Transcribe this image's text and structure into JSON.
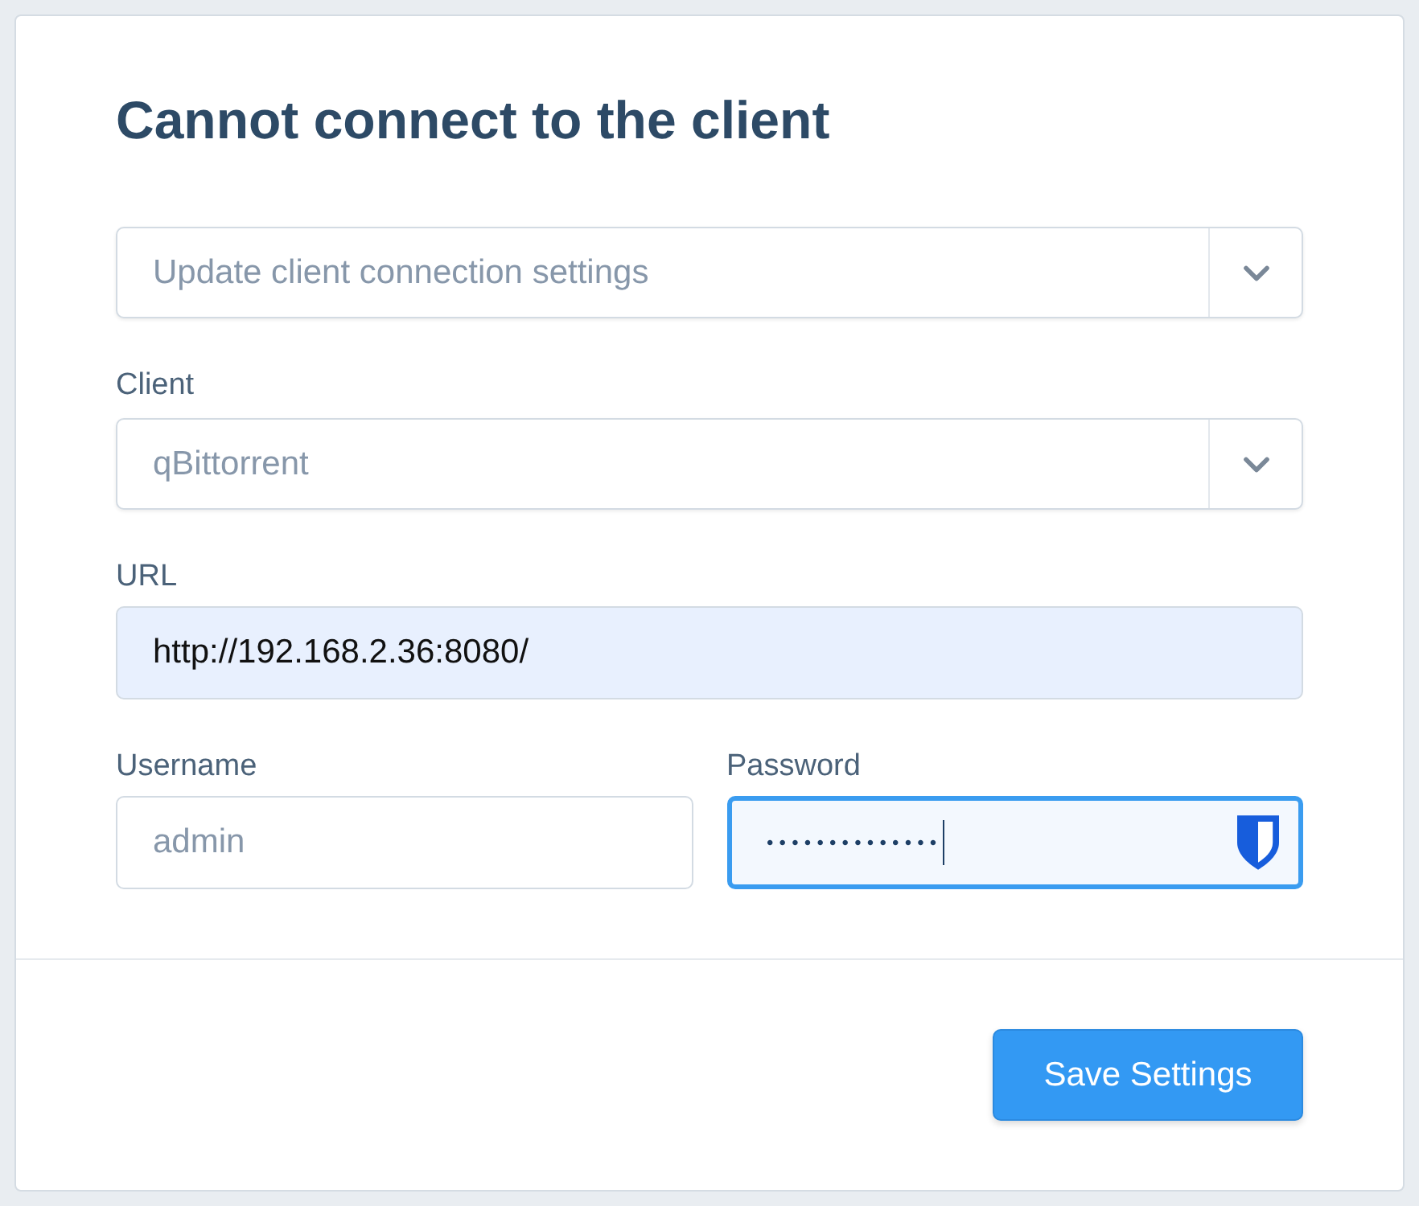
{
  "title": "Cannot connect to the client",
  "action_select": {
    "placeholder": "Update client connection settings"
  },
  "client_select": {
    "label": "Client",
    "value": "qBittorrent"
  },
  "url_field": {
    "label": "URL",
    "value": "http://192.168.2.36:8080/",
    "autofilled": true
  },
  "credentials": [
    {
      "label": "Username",
      "placeholder": "admin",
      "focused": false,
      "password_manager": false
    },
    {
      "label": "Password",
      "value": "••••••••••••••",
      "focused": true,
      "password_manager": true
    }
  ],
  "buttons": [
    {
      "label": "Save Settings"
    }
  ]
}
